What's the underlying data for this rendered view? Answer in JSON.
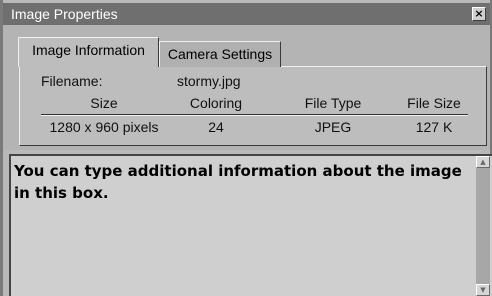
{
  "window": {
    "title": "Image Properties",
    "close_glyph": "×"
  },
  "tabs": [
    {
      "label": "Image Information",
      "active": true
    },
    {
      "label": "Camera Settings",
      "active": false
    }
  ],
  "info": {
    "filename_label": "Filename:",
    "filename_value": "stormy.jpg",
    "columns": [
      "Size",
      "Coloring",
      "File Type",
      "File Size"
    ],
    "values": [
      "1280 x 960 pixels",
      "24",
      "JPEG",
      "127 K"
    ]
  },
  "notes": {
    "text": "You can type additional information about the image in this box."
  },
  "scrollbar": {
    "up_icon": "scroll-up-arrow-icon",
    "down_icon": "scroll-down-arrow-icon"
  },
  "colors": {
    "titlebar": "#6f6f6f",
    "panel": "#bdbdbd",
    "notes_bg": "#cfcfcf"
  }
}
